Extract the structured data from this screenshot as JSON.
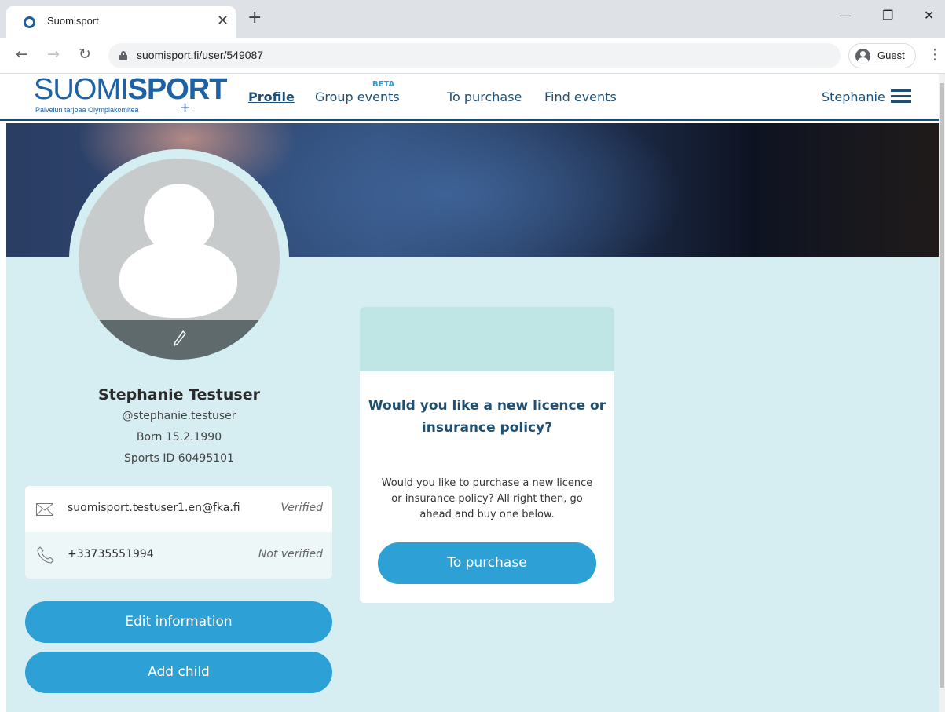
{
  "browser": {
    "tab_title": "Suomisport",
    "url": "suomisport.fi/user/549087",
    "profile_label": "Guest"
  },
  "header": {
    "logo_light": "SUOMI",
    "logo_bold": "SPORT",
    "logo_subtitle": "Palvelun tarjoaa Olympiakomitea",
    "nav": {
      "profile": "Profile",
      "group_events": "Group events",
      "group_events_badge": "BETA",
      "to_purchase": "To purchase",
      "find_events": "Find events"
    },
    "user_name": "Stephanie"
  },
  "profile": {
    "full_name": "Stephanie Testuser",
    "username": "@stephanie.testuser",
    "born": "Born 15.2.1990",
    "sports_id": "Sports ID 60495101",
    "email": "suomisport.testuser1.en@fka.fi",
    "email_status": "Verified",
    "phone": "+33735551994",
    "phone_status": "Not verified",
    "edit_button": "Edit information",
    "add_child_button": "Add child"
  },
  "promo": {
    "title": "Would you like a new licence or insurance policy?",
    "description": "Would you like to purchase a new licence or insurance policy? All right then, go ahead and buy one below.",
    "button": "To purchase"
  },
  "colors": {
    "brand_blue": "#1d62a4",
    "nav_text": "#1f4f72",
    "button_blue": "#2da1d6",
    "content_bg": "#d6eef2",
    "promo_accent": "#bfe6e5"
  }
}
